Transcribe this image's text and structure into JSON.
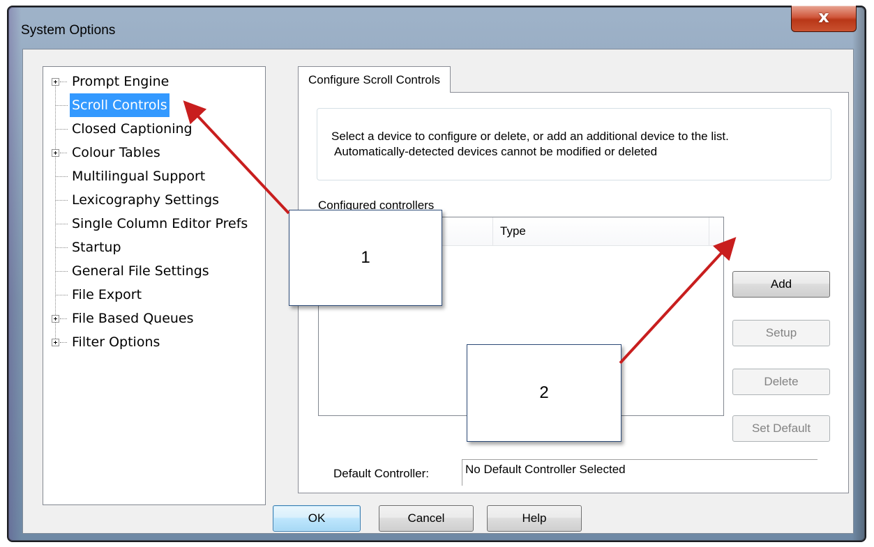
{
  "window": {
    "title": "System Options",
    "close_label": "x"
  },
  "tree": {
    "items": [
      {
        "label": "Prompt Engine",
        "expandable": true,
        "selected": false
      },
      {
        "label": "Scroll Controls",
        "expandable": false,
        "selected": true
      },
      {
        "label": "Closed Captioning",
        "expandable": false,
        "selected": false
      },
      {
        "label": "Colour Tables",
        "expandable": true,
        "selected": false
      },
      {
        "label": "Multilingual Support",
        "expandable": false,
        "selected": false
      },
      {
        "label": "Lexicography Settings",
        "expandable": false,
        "selected": false
      },
      {
        "label": "Single Column Editor Prefs",
        "expandable": false,
        "selected": false
      },
      {
        "label": "Startup",
        "expandable": false,
        "selected": false
      },
      {
        "label": "General File Settings",
        "expandable": false,
        "selected": false
      },
      {
        "label": "File Export",
        "expandable": false,
        "selected": false
      },
      {
        "label": "File Based Queues",
        "expandable": true,
        "selected": false
      },
      {
        "label": "Filter Options",
        "expandable": true,
        "selected": false
      }
    ]
  },
  "tab": {
    "label": "Configure Scroll Controls"
  },
  "info": {
    "line1": "Select a device to configure or delete, or add an additional device to the list.",
    "line2": "Automatically-detected devices cannot be modified or deleted"
  },
  "controllers": {
    "section_label": "Configured controllers",
    "columns": [
      "",
      "Type",
      ""
    ]
  },
  "side_buttons": {
    "add": "Add",
    "setup": "Setup",
    "delete": "Delete",
    "set_default": "Set Default"
  },
  "default_controller": {
    "label": "Default Controller:",
    "value": "No Default Controller Selected"
  },
  "dialog_buttons": {
    "ok": "OK",
    "cancel": "Cancel",
    "help": "Help"
  },
  "annotations": {
    "callout1": "1",
    "callout2": "2",
    "arrow_color": "#c81e1e"
  }
}
